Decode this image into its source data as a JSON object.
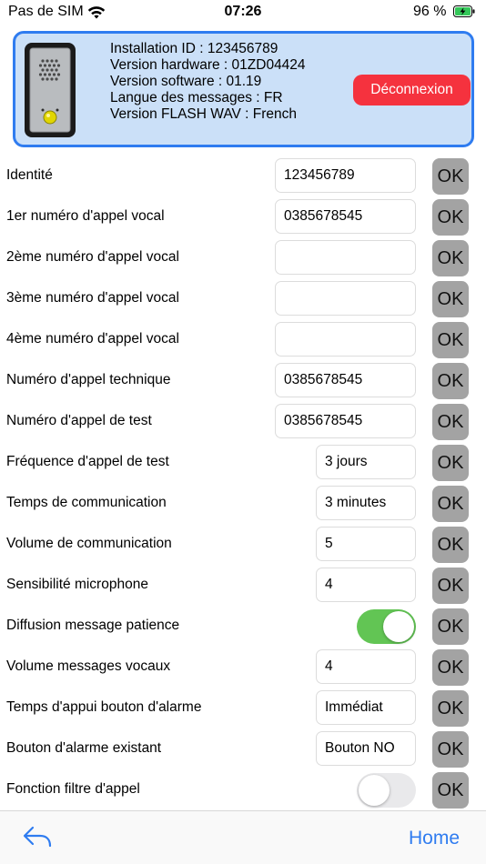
{
  "status_bar": {
    "carrier": "Pas de SIM",
    "time": "07:26",
    "battery_percent": "96 %"
  },
  "device": {
    "info_lines": [
      "Installation ID : 123456789",
      "Version hardware : 01ZD04424",
      "Version software : 01.19",
      "Langue des messages : FR",
      "Version FLASH WAV : French"
    ],
    "logout_label": "Déconnexion"
  },
  "ok_label": "OK",
  "rows": [
    {
      "label": "Identité",
      "value": "123456789"
    },
    {
      "label": "1er numéro d'appel vocal",
      "value": "0385678545"
    },
    {
      "label": "2ème numéro d'appel vocal",
      "value": ""
    },
    {
      "label": "3ème numéro d'appel vocal",
      "value": ""
    },
    {
      "label": "4ème numéro d'appel vocal",
      "value": ""
    },
    {
      "label": "Numéro d'appel technique",
      "value": "0385678545"
    },
    {
      "label": "Numéro d'appel de test",
      "value": "0385678545"
    },
    {
      "label": "Fréquence d'appel de test",
      "value": "3 jours"
    },
    {
      "label": "Temps de communication",
      "value": "3 minutes"
    },
    {
      "label": "Volume de communication",
      "value": "5"
    },
    {
      "label": "Sensibilité microphone",
      "value": "4"
    },
    {
      "label": "Diffusion message patience",
      "toggle": true
    },
    {
      "label": "Volume messages vocaux",
      "value": "4"
    },
    {
      "label": "Temps d'appui bouton d'alarme",
      "value": "Immédiat"
    },
    {
      "label": "Bouton d'alarme existant",
      "value": "Bouton NO"
    },
    {
      "label": "Fonction filtre d'appel",
      "toggle": false
    }
  ],
  "toolbar": {
    "back_icon": "back-arrow-icon",
    "home_label": "Home"
  },
  "colors": {
    "accent": "#2f7cf0",
    "card_background": "#cbe0f8",
    "logout": "#f5323e",
    "toggle_on": "#62c554",
    "ok_button": "#a3a3a3"
  }
}
